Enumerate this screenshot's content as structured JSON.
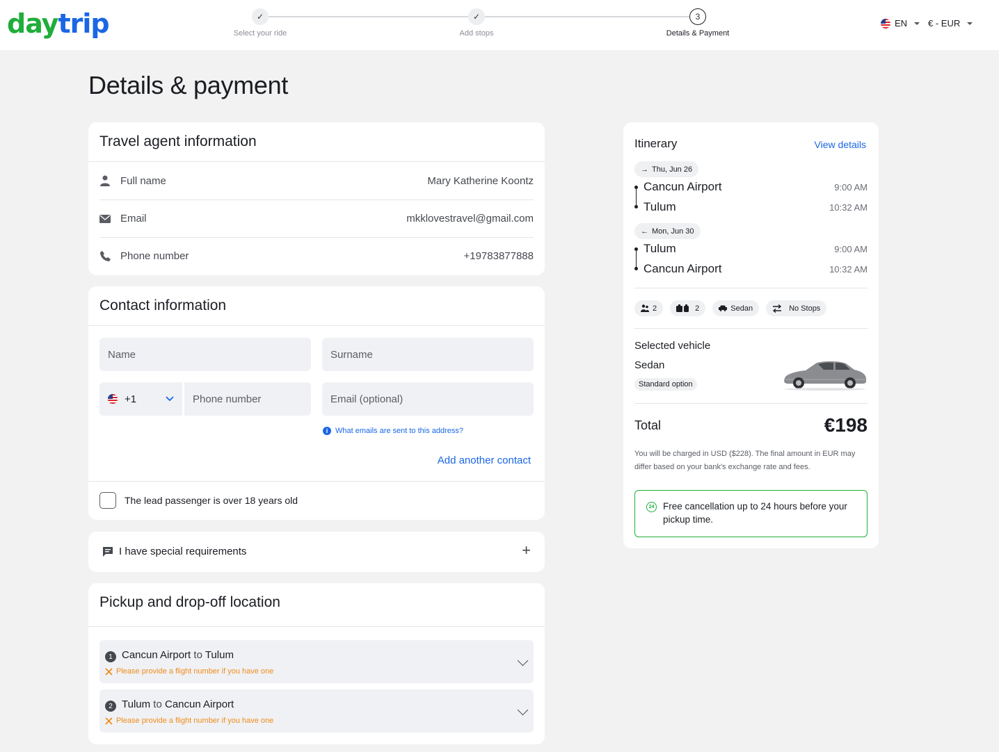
{
  "brand": {
    "logo_left": "day",
    "logo_right": "trip"
  },
  "steps": [
    {
      "label": "Select your ride",
      "state": "done"
    },
    {
      "label": "Add stops",
      "state": "done"
    },
    {
      "label": "Details & Payment",
      "number": "3",
      "state": "active"
    }
  ],
  "header": {
    "language": "EN",
    "currency": "€ - EUR"
  },
  "page_title": "Details & payment",
  "travel_agent": {
    "title": "Travel agent information",
    "rows": [
      {
        "label": "Full name",
        "value": "Mary Katherine Koontz",
        "icon": "person-icon"
      },
      {
        "label": "Email",
        "value": "mkklovestravel@gmail.com",
        "icon": "envelope-icon"
      },
      {
        "label": "Phone number",
        "value": "+19783877888",
        "icon": "phone-icon"
      }
    ]
  },
  "contact": {
    "title": "Contact information",
    "name_placeholder": "Name",
    "surname_placeholder": "Surname",
    "country_code": "+1",
    "phone_placeholder": "Phone number",
    "email_placeholder": "Email (optional)",
    "email_help": "What emails are sent to this address?",
    "add_contact": "Add another contact",
    "lead_passenger": "The lead passenger is over 18 years old"
  },
  "special_requirements": {
    "label": "I have special requirements"
  },
  "pickup": {
    "title": "Pickup and drop-off location",
    "routes": [
      {
        "number": "1",
        "from": "Cancun Airport",
        "connector": "to",
        "to": "Tulum",
        "warning": "Please provide a flight number if you have one"
      },
      {
        "number": "2",
        "from": "Tulum",
        "connector": "to",
        "to": "Cancun Airport",
        "warning": "Please provide a flight number if you have one"
      }
    ]
  },
  "itinerary": {
    "title": "Itinerary",
    "view_details": "View details",
    "legs": [
      {
        "date": "Thu, Jun 26",
        "direction": "outbound",
        "from": "Cancun Airport",
        "from_time": "9:00 AM",
        "to": "Tulum",
        "to_time": "10:32 AM"
      },
      {
        "date": "Mon, Jun 30",
        "direction": "return",
        "from": "Tulum",
        "from_time": "9:00 AM",
        "to": "Cancun Airport",
        "to_time": "10:32 AM"
      }
    ],
    "chips": {
      "passengers": "2",
      "luggage": "2",
      "vehicle": "Sedan",
      "stops": "No Stops"
    },
    "selected_vehicle_title": "Selected vehicle",
    "vehicle_name": "Sedan",
    "vehicle_option": "Standard option",
    "total_label": "Total",
    "total_value": "€198",
    "charge_note": "You will be charged in USD ($228). The final amount in EUR may differ based on your bank's exchange rate and fees.",
    "cancellation": "Free cancellation up to 24 hours before your pickup time.",
    "cancellation_icon_text": "24",
    "accent_green": "#1fae3a",
    "accent_blue": "#1a66e5",
    "warning_orange": "#f08c1a"
  }
}
